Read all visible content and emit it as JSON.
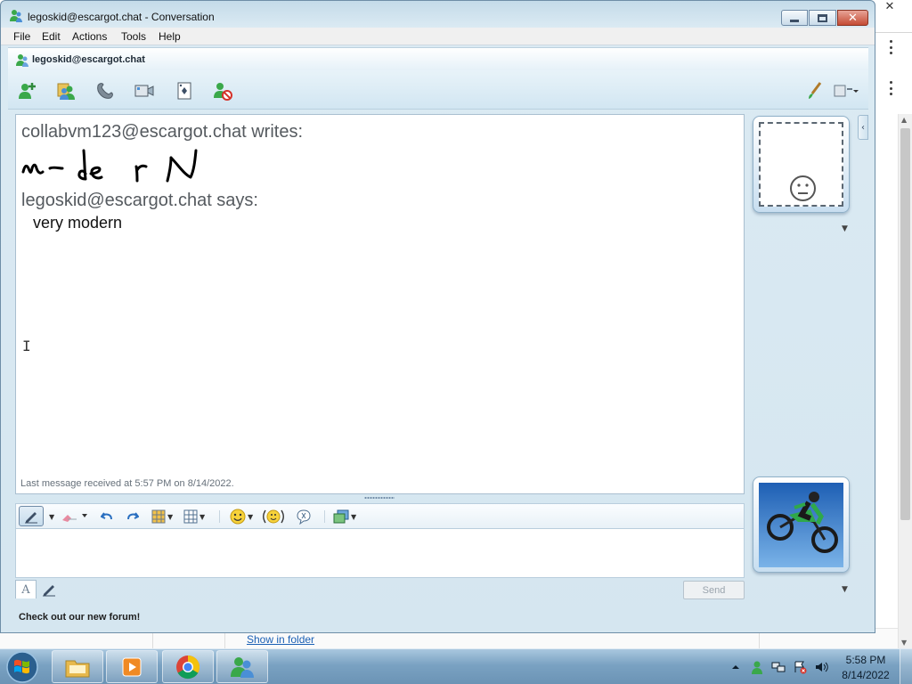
{
  "window": {
    "title": "legoskid@escargot.chat - Conversation",
    "close_label": "✕"
  },
  "menu": [
    "File",
    "Edit",
    "Actions",
    "Tools",
    "Help"
  ],
  "contact": {
    "name": "legoskid@escargot.chat"
  },
  "toolbar": {
    "icons": [
      "invite-contact-icon",
      "share-files-icon",
      "call-icon",
      "video-icon",
      "games-icon",
      "block-icon",
      "paint-brush-icon",
      "activities-icon"
    ]
  },
  "conversation": {
    "messages": [
      {
        "header": "collabvm123@escargot.chat writes:",
        "body_type": "ink"
      },
      {
        "header": "legoskid@escargot.chat says:",
        "body": "very modern"
      }
    ],
    "last_received": "Last message received at 5:57 PM on 8/14/2022."
  },
  "input": {
    "value": "",
    "send_label": "Send",
    "text_mode_label": "A"
  },
  "status": {
    "forum_text": "Check out our new forum!"
  },
  "background_window": {
    "download_link": "Show in folder",
    "close_label": "✕"
  },
  "taskbar": {
    "clock_time": "5:58 PM",
    "clock_date": "8/14/2022",
    "apps": [
      "windows-explorer-icon",
      "media-player-icon",
      "chrome-icon",
      "messenger-icon"
    ]
  },
  "colors": {
    "accent": "#6e8ea7",
    "window_frame": "#c4dbe9",
    "taskbar": "#7aa2c2",
    "link": "#1a5fb4"
  }
}
